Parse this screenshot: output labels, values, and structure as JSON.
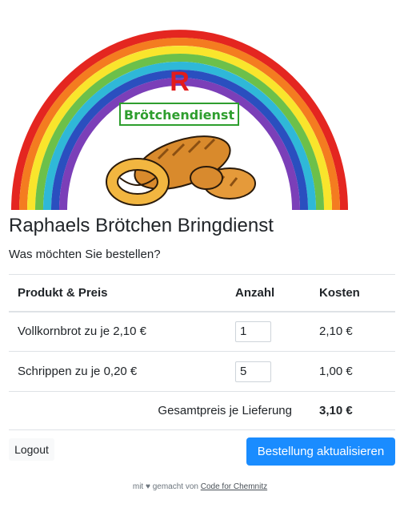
{
  "hero": {
    "logo_letter": "R",
    "badge_text": "Brötchendienst"
  },
  "page": {
    "title": "Raphaels Brötchen Bringdienst",
    "subtitle": "Was möchten Sie bestellen?"
  },
  "table": {
    "headers": {
      "product": "Produkt & Preis",
      "quantity": "Anzahl",
      "cost": "Kosten"
    },
    "rows": [
      {
        "product": "Vollkornbrot zu je 2,10 €",
        "quantity": "1",
        "cost": "2,10 €"
      },
      {
        "product": "Schrippen zu je 0,20 €",
        "quantity": "5",
        "cost": "1,00 €"
      }
    ],
    "total_label": "Gesamtpreis je Lieferung",
    "total_value": "3,10 €"
  },
  "actions": {
    "logout_label": "Logout",
    "update_label": "Bestellung aktualisieren"
  },
  "footer": {
    "prefix": "mit ♥ gemacht von ",
    "link_text": "Code for Chemnitz"
  },
  "colors": {
    "primary": "#1a8cff",
    "logo_red": "#e31b1b",
    "badge_green": "#2e9e2e"
  }
}
